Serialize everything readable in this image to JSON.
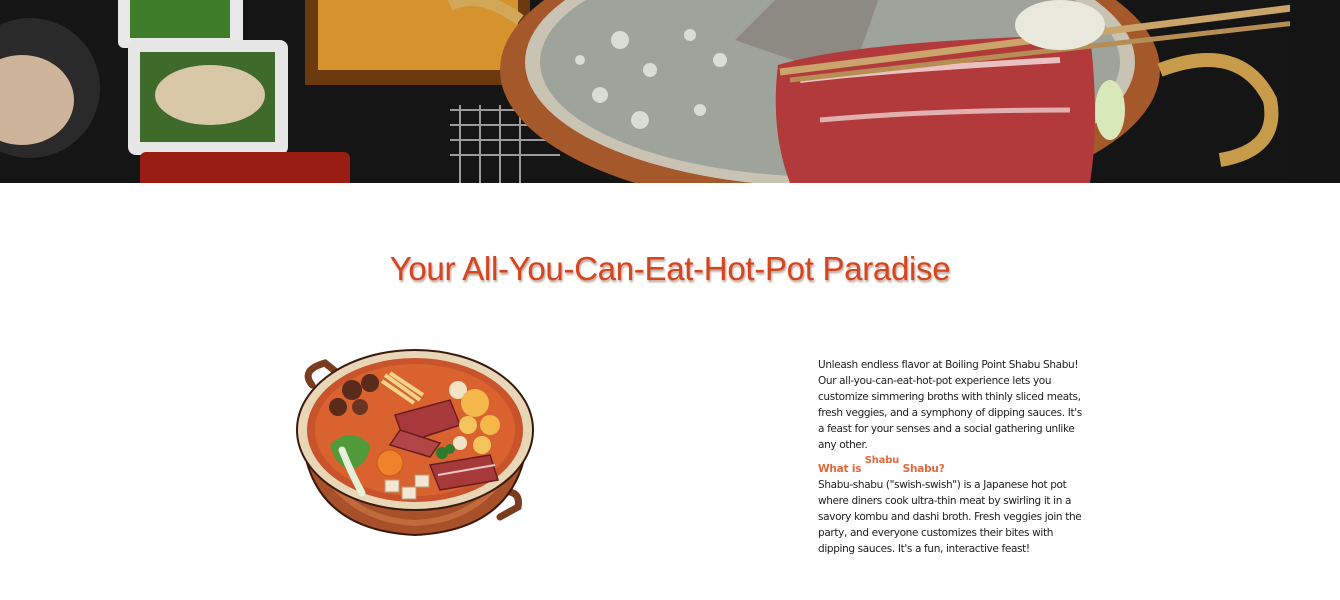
{
  "hero": {
    "image": "hot-pot-photo"
  },
  "main": {
    "title": "Your All-You-Can-Eat-Hot-Pot Paradise",
    "intro": "Unleash endless flavor at Boiling Point Shabu Shabu! Our all-you-can-eat-hot-pot experience lets you customize simmering broths with thinly sliced meats, fresh veggies, and a symphony of dipping sauces. It's a feast for your senses and a social gathering unlike any other.",
    "subhead": {
      "prefix": "What is",
      "raised": "Shabu",
      "suffix": "Shabu?"
    },
    "body": "Shabu-shabu (\"swish-swish\") is a Japanese hot pot where diners cook ultra-thin meat by swirling it in a savory kombu and dashi broth. Fresh veggies join the party, and everyone customizes their bites with dipping sauces. It's a fun, interactive feast!"
  },
  "colors": {
    "title": "#d5461f",
    "subhead": "#e2683b",
    "text": "#1e1e1e",
    "background": "#ffffff"
  }
}
